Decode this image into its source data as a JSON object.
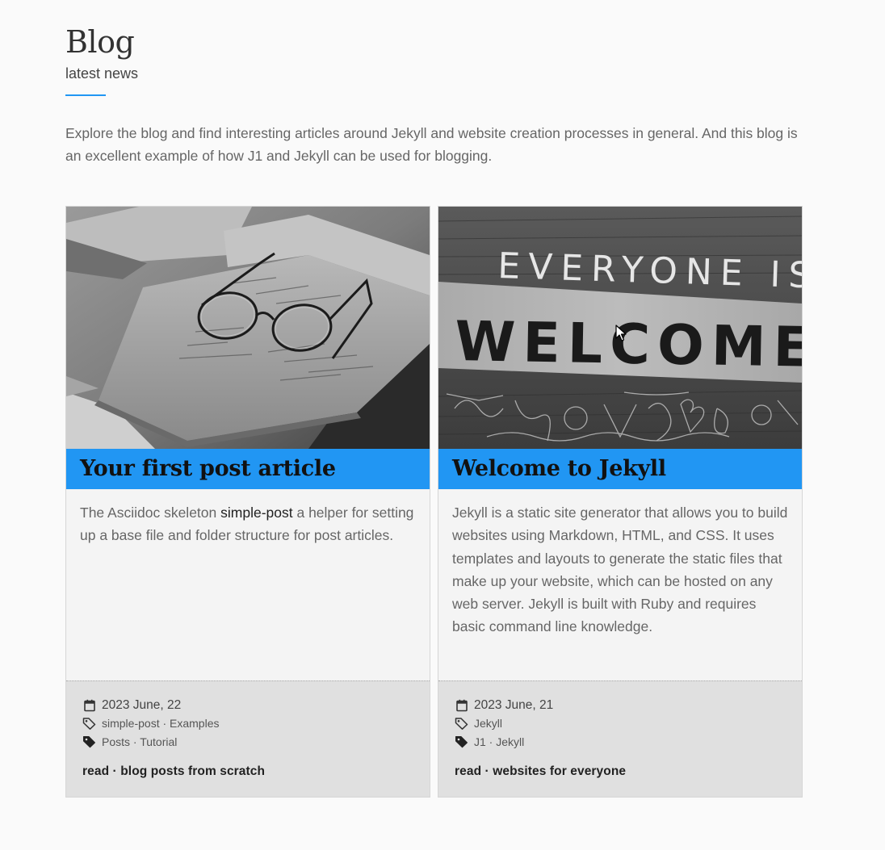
{
  "header": {
    "title": "Blog",
    "subtitle": "latest news"
  },
  "intro": "Explore the blog and find interesting articles around Jekyll and website creation processes in general. And this blog is an excellent example of how J1 and Jekyll can be used for blogging.",
  "accent_color": "#2196f3",
  "cards": [
    {
      "title": "Your first post article",
      "image": "notebook-with-glasses-photo",
      "body_before": "The Asciidoc skeleton ",
      "body_highlight": "simple-post",
      "body_after": " a helper for setting up a base file and folder structure for post articles.",
      "date": "2023 June, 22",
      "tags": "simple-post · Examples",
      "categories": "Posts · Tutorial",
      "read_link": "read · blog posts from scratch"
    },
    {
      "title": "Welcome to Jekyll",
      "image": "everyone-is-welcome-sign-photo",
      "image_text_top": "EVERYONE IS",
      "image_text_big": "WELCOME",
      "body": "Jekyll is a static site generator that allows you to build websites using Markdown, HTML, and CSS. It uses templates and layouts to generate the static files that make up your website, which can be hosted on any web server. Jekyll is built with Ruby and requires basic command line knowledge.",
      "date": "2023 June, 21",
      "tags": "Jekyll",
      "categories": "J1 · Jekyll",
      "read_link": "read · websites for everyone"
    }
  ],
  "icons": {
    "date": "calendar-icon",
    "tags": "tag-outline-icon",
    "categories": "tag-filled-icon"
  }
}
